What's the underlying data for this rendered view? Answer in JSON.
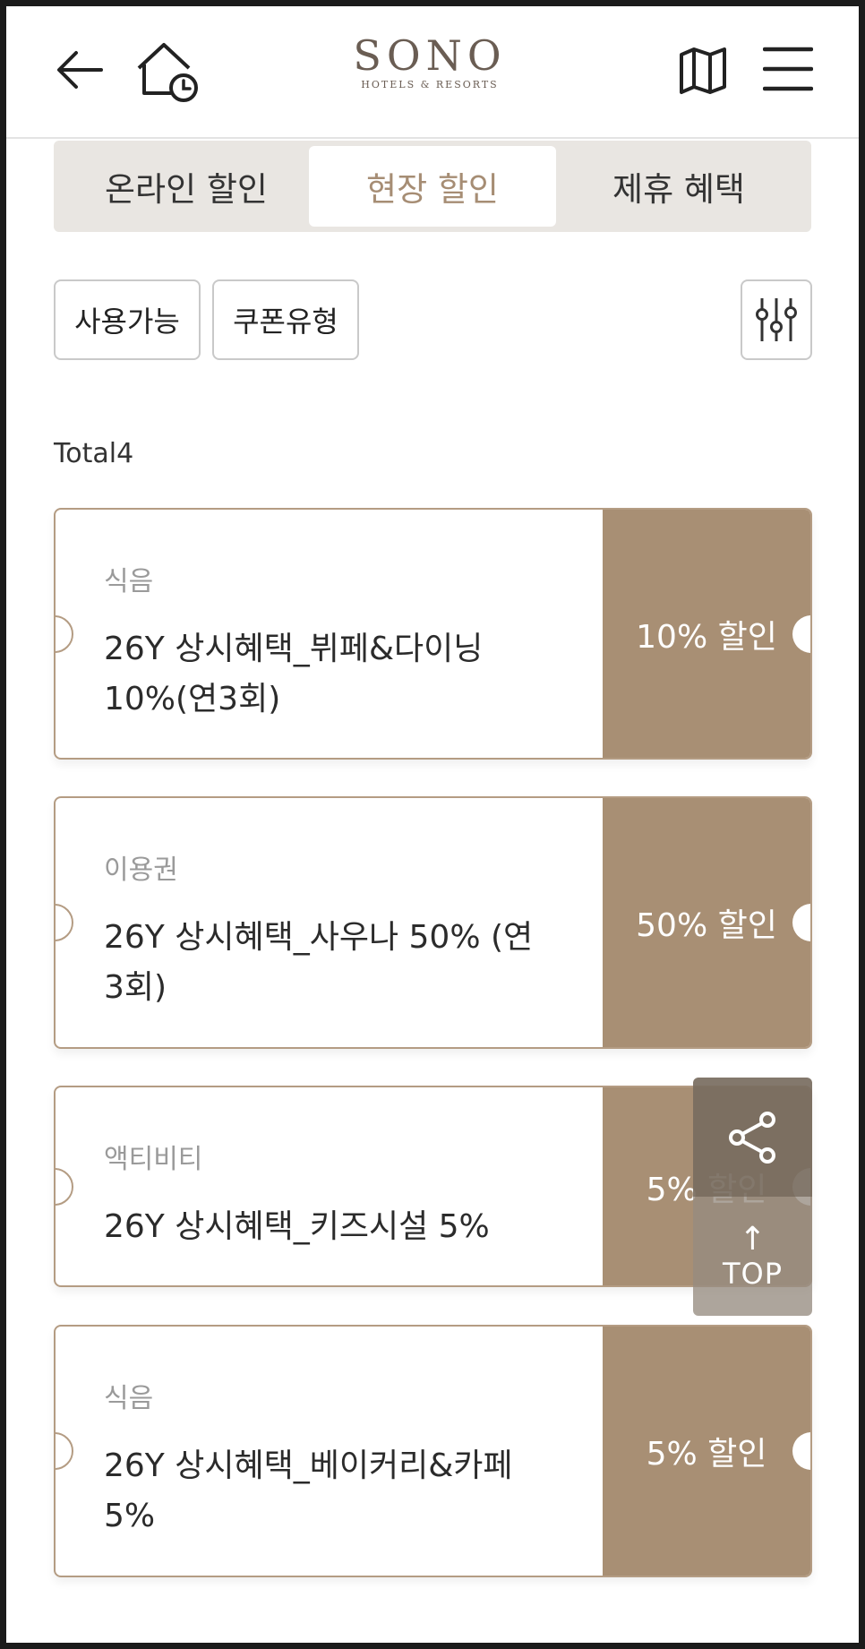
{
  "header": {
    "logo_main": "SONO",
    "logo_sub": "HOTELS & RESORTS",
    "icons": [
      "arrow-left-icon",
      "home-clock-icon",
      "map-icon",
      "menu-icon"
    ]
  },
  "tabs": [
    {
      "label": "온라인 할인",
      "active": false
    },
    {
      "label": "현장 할인",
      "active": true
    },
    {
      "label": "제휴 혜택",
      "active": false
    }
  ],
  "filters": {
    "available": "사용가능",
    "coupon_type": "쿠폰유형"
  },
  "total": {
    "label": "Total",
    "count": "4"
  },
  "coupons": [
    {
      "category": "식음",
      "name": "26Y 상시혜택_뷔페&다이닝 10%(연3회)",
      "discount": "10% 할인"
    },
    {
      "category": "이용권",
      "name": "26Y 상시혜택_사우나 50% (연3회)",
      "discount": "50% 할인"
    },
    {
      "category": "액티비티",
      "name": "26Y 상시혜택_키즈시설 5%",
      "discount": "5% 할인"
    },
    {
      "category": "식음",
      "name": "26Y 상시혜택_베이커리&카페 5%",
      "discount": "5% 할인"
    }
  ],
  "floating": {
    "top_arrow": "↑",
    "top_label": "TOP"
  },
  "colors": {
    "accent": "#a88f74",
    "active_tab_text": "#a68d74",
    "tab_bg": "#e9e6e2"
  }
}
